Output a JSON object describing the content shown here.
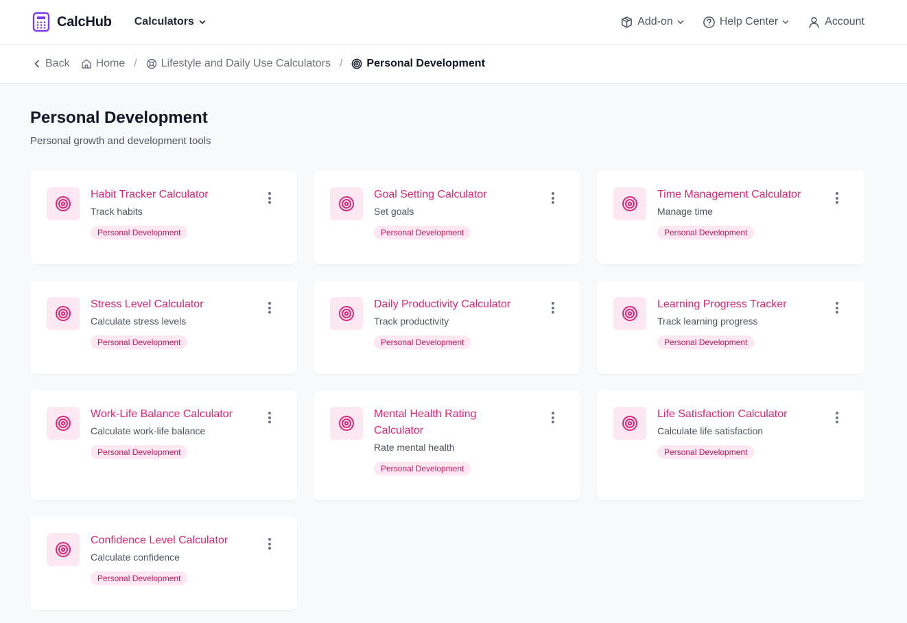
{
  "header": {
    "brand": "CalcHub",
    "calculators_label": "Calculators",
    "addon_label": "Add-on",
    "help_label": "Help Center",
    "account_label": "Account"
  },
  "breadcrumb": {
    "back": "Back",
    "home": "Home",
    "category": "Lifestyle and Daily Use Calculators",
    "current": "Personal Development"
  },
  "page": {
    "title": "Personal Development",
    "subtitle": "Personal growth and development tools"
  },
  "colors": {
    "accent": "#db2777",
    "tag_bg": "#fce7f3",
    "brand_icon": "#7c3aed"
  },
  "cards": [
    {
      "title": "Habit Tracker Calculator",
      "desc": "Track habits",
      "tag": "Personal Development",
      "icon": "target-icon"
    },
    {
      "title": "Goal Setting Calculator",
      "desc": "Set goals",
      "tag": "Personal Development",
      "icon": "target-icon"
    },
    {
      "title": "Time Management Calculator",
      "desc": "Manage time",
      "tag": "Personal Development",
      "icon": "target-icon"
    },
    {
      "title": "Stress Level Calculator",
      "desc": "Calculate stress levels",
      "tag": "Personal Development",
      "icon": "target-icon"
    },
    {
      "title": "Daily Productivity Calculator",
      "desc": "Track productivity",
      "tag": "Personal Development",
      "icon": "target-icon"
    },
    {
      "title": "Learning Progress Tracker",
      "desc": "Track learning progress",
      "tag": "Personal Development",
      "icon": "target-icon"
    },
    {
      "title": "Work-Life Balance Calculator",
      "desc": "Calculate work-life balance",
      "tag": "Personal Development",
      "icon": "target-icon"
    },
    {
      "title": "Mental Health Rating Calculator",
      "desc": "Rate mental health",
      "tag": "Personal Development",
      "icon": "target-icon"
    },
    {
      "title": "Life Satisfaction Calculator",
      "desc": "Calculate life satisfaction",
      "tag": "Personal Development",
      "icon": "target-icon"
    },
    {
      "title": "Confidence Level Calculator",
      "desc": "Calculate confidence",
      "tag": "Personal Development",
      "icon": "target-icon"
    }
  ]
}
